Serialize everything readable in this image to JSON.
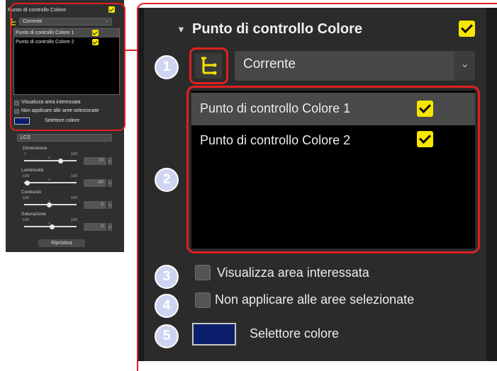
{
  "panel": {
    "title": "Punto di controllo Colore",
    "enabled": true,
    "mode_select": "Corrente",
    "list_items": [
      {
        "label": "Punto di controllo Colore 1",
        "checked": true,
        "selected": true
      },
      {
        "label": "Punto di controllo Colore 2",
        "checked": true,
        "selected": false
      }
    ],
    "show_area_label": "Visualizza area interessata",
    "not_apply_label": "Non applicare alle aree selezionate",
    "color_picker_label": "Selettore colore",
    "color_picker_value": "#0b1e6b"
  },
  "small_panel": {
    "lcs_select": "LCS",
    "reset_label": "Ripristina",
    "sliders": [
      {
        "label": "Dimensione",
        "min": "1",
        "max": "100",
        "value": "70"
      },
      {
        "label": "Luminosità",
        "min": "-100",
        "max": "100",
        "value": "-90"
      },
      {
        "label": "Contrasto",
        "min": "-100",
        "max": "100",
        "value": "0"
      },
      {
        "label": "Saturazione",
        "min": "-100",
        "max": "100",
        "value": "0"
      }
    ]
  },
  "callouts": [
    "1",
    "2",
    "3",
    "4",
    "5"
  ],
  "colors": {
    "highlight": "#e02020",
    "accent_check": "#f7e600",
    "callout": "#cfd4f2",
    "panel_bg": "#2b2b2b",
    "list_bg": "#000000",
    "selected_row": "#4a4a4a"
  }
}
